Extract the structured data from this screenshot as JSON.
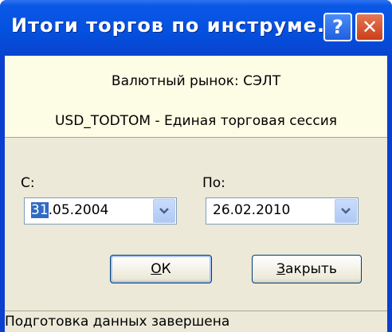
{
  "window": {
    "title": "Итоги торгов по инструме...",
    "help_label": "?",
    "close_label": "✕"
  },
  "header": {
    "market": "Валютный рынок: СЭЛТ",
    "instrument": "USD_TODTOM - Единая торговая сессия"
  },
  "form": {
    "from_label": "С:",
    "from_date_selected": "31",
    "from_date_rest": ".05.2004",
    "to_label": "По:",
    "to_date": "26.02.2010"
  },
  "buttons": {
    "ok_underlined": "О",
    "ok_rest": "К",
    "close_underlined": "З",
    "close_rest": "акрыть"
  },
  "status": {
    "text": "Подготовка данных завершена"
  },
  "colors": {
    "titlebar": "#0451e0",
    "client": "#ece9d8",
    "header": "#fdfde5",
    "selection": "#316ac5"
  }
}
